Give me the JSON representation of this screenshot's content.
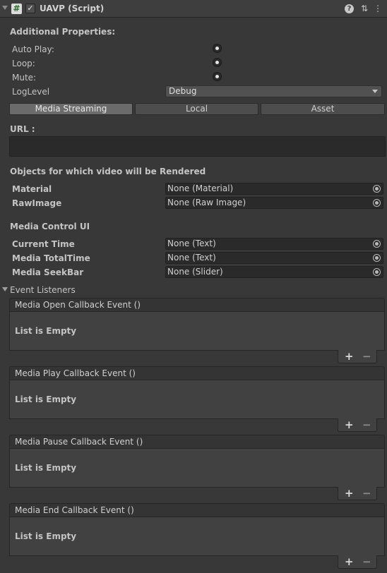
{
  "header": {
    "title": "UAVP (Script)",
    "enabled_checkmark": "✓",
    "script_icon_glyph": "#",
    "help_icon": "?",
    "settings_icon": "⇅",
    "menu_icon": "⋮"
  },
  "additional": {
    "heading": "Additional Properties:",
    "auto_play_label": "Auto Play:",
    "loop_label": "Loop:",
    "mute_label": "Mute:",
    "log_level_label": "LogLevel",
    "log_level_value": "Debug"
  },
  "source_tabs": {
    "tabs": [
      "Media Streaming",
      "Local",
      "Asset"
    ],
    "active": "Media Streaming"
  },
  "url": {
    "label": "URL :",
    "value": ""
  },
  "render_targets": {
    "heading": "Objects for which video will be Rendered",
    "material_label": "Material",
    "material_value": "None (Material)",
    "rawimage_label": "RawImage",
    "rawimage_value": "None (Raw Image)"
  },
  "media_control": {
    "heading": "Media Control UI",
    "current_time_label": "Current Time",
    "current_time_value": "None (Text)",
    "total_time_label": "Media TotalTime",
    "total_time_value": "None (Text)",
    "seekbar_label": "Media SeekBar",
    "seekbar_value": "None (Slider)"
  },
  "events": {
    "heading": "Event Listeners",
    "list": [
      {
        "title": "Media Open Callback Event ()",
        "empty_text": "List is Empty"
      },
      {
        "title": "Media Play Callback Event ()",
        "empty_text": "List is Empty"
      },
      {
        "title": "Media Pause Callback Event ()",
        "empty_text": "List is Empty"
      },
      {
        "title": "Media End Callback Event ()",
        "empty_text": "List is Empty"
      }
    ],
    "add_label": "+",
    "remove_label": "−"
  }
}
